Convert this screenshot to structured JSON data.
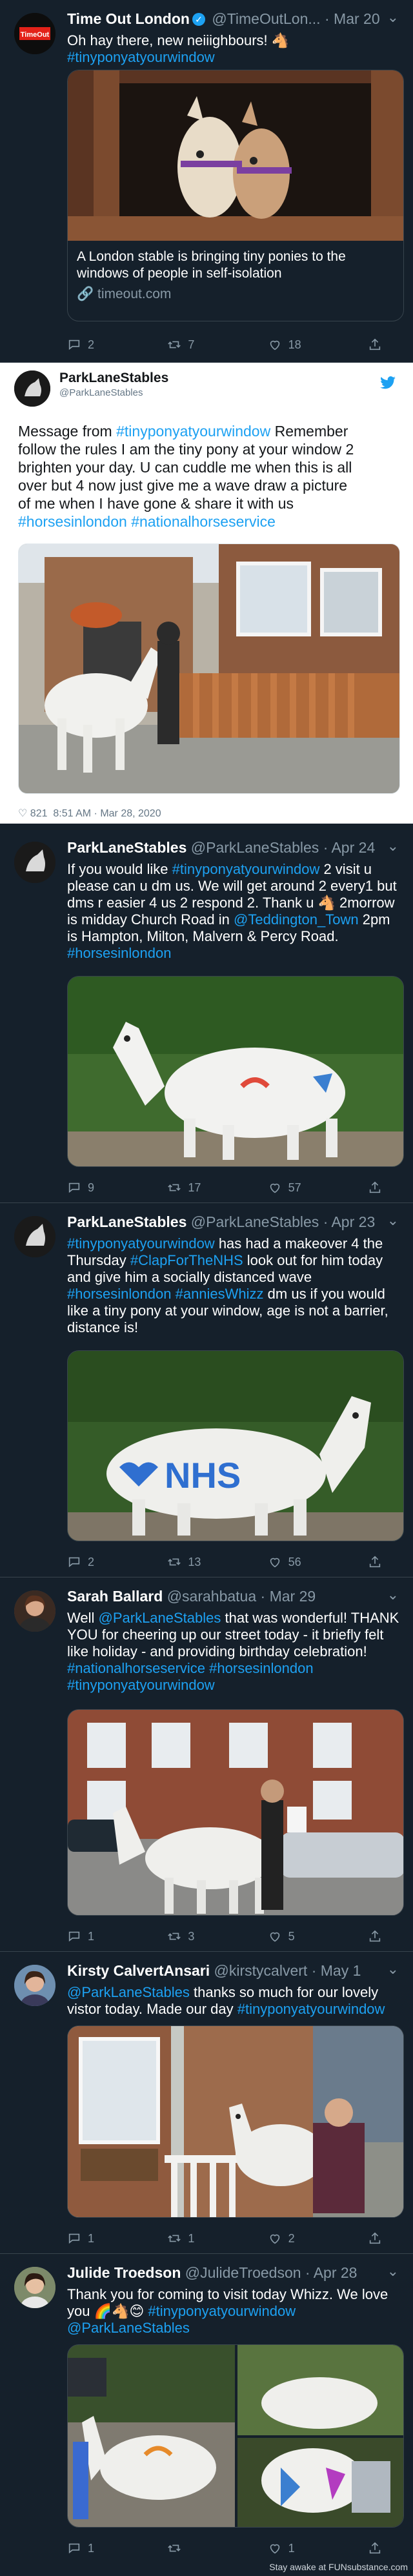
{
  "tweets": [
    {
      "name": "Time Out London",
      "handle": "@TimeOutLon...",
      "date": "Mar 20",
      "lines": [
        [
          {
            "t": "Oh hay there, new neiiighbours! 🐴"
          }
        ],
        [
          {
            "t": "#tinyponyatyourwindow",
            "h": true
          }
        ]
      ],
      "card_title": "A London stable is bringing tiny ponies to the windows of people in self-isolation",
      "card_title_lines": [
        "A London stable is bringing tiny ponies to the",
        "windows of people in self-isolation"
      ],
      "card_domain": "timeout.com",
      "replies": "2",
      "retweets": "7",
      "likes": "18"
    },
    {
      "name": "ParkLaneStables",
      "handle": "@ParkLaneStables",
      "lines": [
        [
          {
            "t": "Message from "
          },
          {
            "t": "#tinyponyatyourwindow",
            "h": true
          },
          {
            "t": " Remember"
          }
        ],
        [
          {
            "t": "follow the rules I am the tiny pony at your window 2"
          }
        ],
        [
          {
            "t": "brighten your day. U can cuddle me when this is all"
          }
        ],
        [
          {
            "t": "over but 4 now just give me a wave draw a picture"
          }
        ],
        [
          {
            "t": "of me when I have gone & share it with us"
          }
        ],
        [
          {
            "t": "#horsesinlondon",
            "h": true
          },
          {
            "t": " "
          },
          {
            "t": "#nationalhorseservice",
            "h": true
          }
        ]
      ],
      "likes": "821",
      "timestamp": "8:51 AM · Mar 28, 2020"
    },
    {
      "name": "ParkLaneStables",
      "handle": "@ParkLaneStables",
      "date": "Apr 24",
      "lines": [
        [
          {
            "t": "If you would like "
          },
          {
            "t": "#tinyponyatyourwindow",
            "h": true
          },
          {
            "t": " 2 visit u"
          }
        ],
        [
          {
            "t": "please can u dm us. We will get around 2 every1 but"
          }
        ],
        [
          {
            "t": "dms r easier 4 us 2 respond 2. Thank u 🐴 2morrow"
          }
        ],
        [
          {
            "t": "is midday Church Road in "
          },
          {
            "t": "@Teddington_Town",
            "h": true
          },
          {
            "t": " 2pm"
          }
        ],
        [
          {
            "t": "is Hampton, Milton, Malvern & Percy Road."
          }
        ],
        [
          {
            "t": "#horsesinlondon",
            "h": true
          }
        ]
      ],
      "replies": "9",
      "retweets": "17",
      "likes": "57"
    },
    {
      "name": "ParkLaneStables",
      "handle": "@ParkLaneStables",
      "date": "Apr 23",
      "lines": [
        [
          {
            "t": "#tinyponyatyourwindow",
            "h": true
          },
          {
            "t": " has had a makeover 4 the"
          }
        ],
        [
          {
            "t": "Thursday "
          },
          {
            "t": "#ClapForTheNHS",
            "h": true
          },
          {
            "t": " look out for him today"
          }
        ],
        [
          {
            "t": "and give him a socially distanced wave"
          }
        ],
        [
          {
            "t": "#horsesinlondon",
            "h": true
          },
          {
            "t": " "
          },
          {
            "t": "#anniesWhizz",
            "h": true
          },
          {
            "t": " dm us if you would"
          }
        ],
        [
          {
            "t": "like a tiny pony at your window, age is not a barrier,"
          }
        ],
        [
          {
            "t": "distance is!"
          }
        ]
      ],
      "painted_text": "NHS",
      "replies": "2",
      "retweets": "13",
      "likes": "56"
    },
    {
      "name": "Sarah Ballard",
      "handle": "@sarahbatua",
      "date": "Mar 29",
      "lines": [
        [
          {
            "t": "Well "
          },
          {
            "t": "@ParkLaneStables",
            "h": true
          },
          {
            "t": " that was wonderful! THANK"
          }
        ],
        [
          {
            "t": "YOU for cheering up our street today - it briefly felt"
          }
        ],
        [
          {
            "t": "like holiday - and providing birthday celebration!"
          }
        ],
        [
          {
            "t": "#nationalhorseservice",
            "h": true
          },
          {
            "t": " "
          },
          {
            "t": "#horsesinlondon",
            "h": true
          }
        ],
        [
          {
            "t": "#tinyponyatyourwindow",
            "h": true
          }
        ]
      ],
      "replies": "1",
      "retweets": "3",
      "likes": "5"
    },
    {
      "name": "Kirsty CalvertAnsari",
      "handle": "@kirstycalvert",
      "date": "May 1",
      "lines": [
        [
          {
            "t": "@ParkLaneStables",
            "h": true
          },
          {
            "t": " thanks so much for our lovely"
          }
        ],
        [
          {
            "t": "vistor today. Made our day "
          },
          {
            "t": "#tinyponyatyourwindow",
            "h": true
          }
        ]
      ],
      "replies": "1",
      "retweets": "1",
      "likes": "2"
    },
    {
      "name": "Julide Troedson",
      "handle": "@JulideTroedson",
      "date": "Apr 28",
      "lines": [
        [
          {
            "t": "Thank you for coming to visit today Whizz. We love"
          }
        ],
        [
          {
            "t": "you 🌈🐴😊 "
          },
          {
            "t": "#tinyponyatyourwindow",
            "h": true
          }
        ],
        [
          {
            "t": "@ParkLaneStables",
            "h": true
          }
        ]
      ],
      "replies": "1",
      "retweets": "",
      "likes": "1"
    }
  ],
  "watermark": "Stay awake at FUNsubstance.com",
  "colors": {
    "bg": "#15202b",
    "accent": "#1da1f2",
    "muted": "#8899a6",
    "divider": "#38444d"
  }
}
